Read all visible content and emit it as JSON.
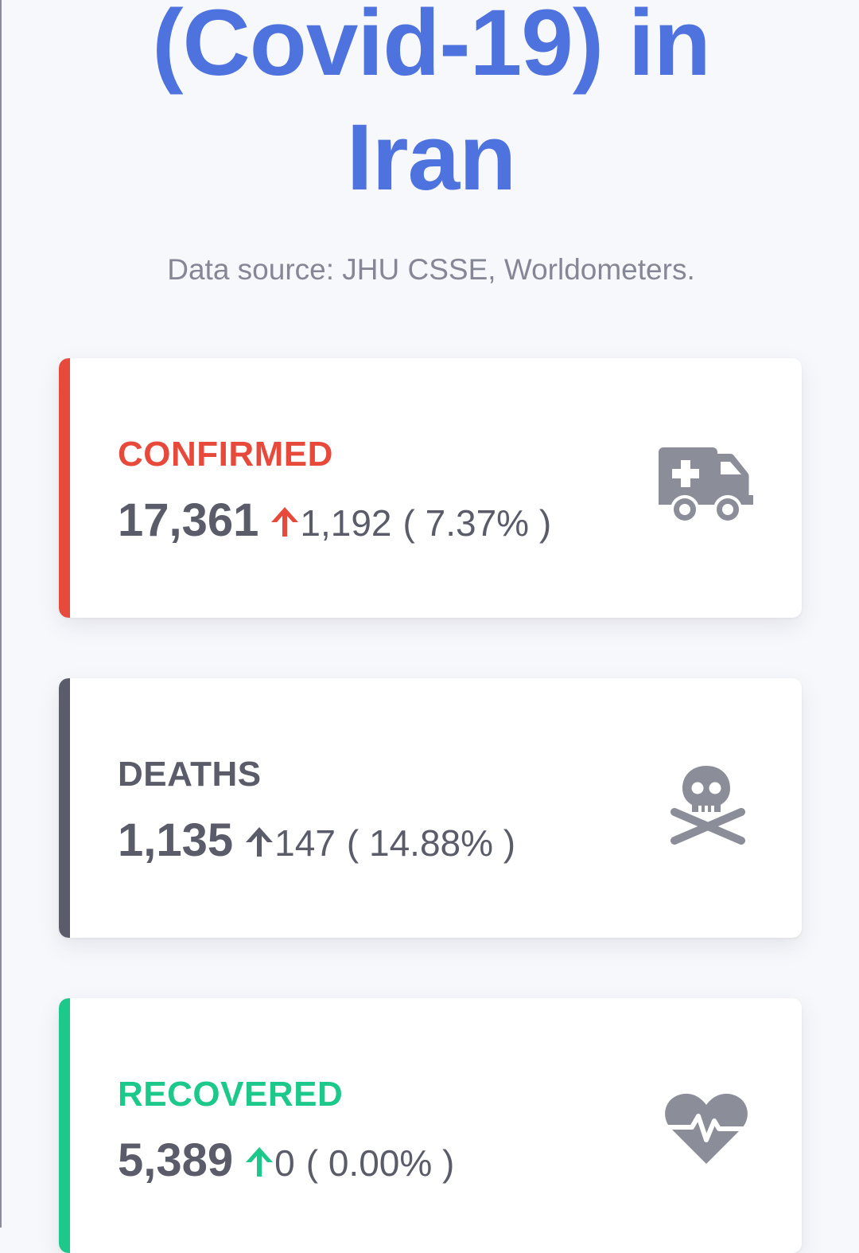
{
  "header": {
    "title_line1": "(Covid-19) in",
    "title_line2": "Iran",
    "source": "Data source: JHU CSSE, Worldometers."
  },
  "cards": {
    "confirmed": {
      "label": "CONFIRMED",
      "total": "17,361",
      "delta": "1,192",
      "percent": "( 7.37% )",
      "accent": "#e74a3b",
      "icon": "ambulance-icon"
    },
    "deaths": {
      "label": "DEATHS",
      "total": "1,135",
      "delta": "147",
      "percent": "( 14.88% )",
      "accent": "#5a5c69",
      "icon": "skull-crossbones-icon"
    },
    "recovered": {
      "label": "RECOVERED",
      "total": "5,389",
      "delta": "0",
      "percent": "( 0.00% )",
      "accent": "#1cc88a",
      "icon": "heartbeat-icon"
    }
  },
  "colors": {
    "title": "#4f73de",
    "muted_text": "#858796",
    "value_text": "#5a5c69",
    "icon": "#8b8d98"
  }
}
